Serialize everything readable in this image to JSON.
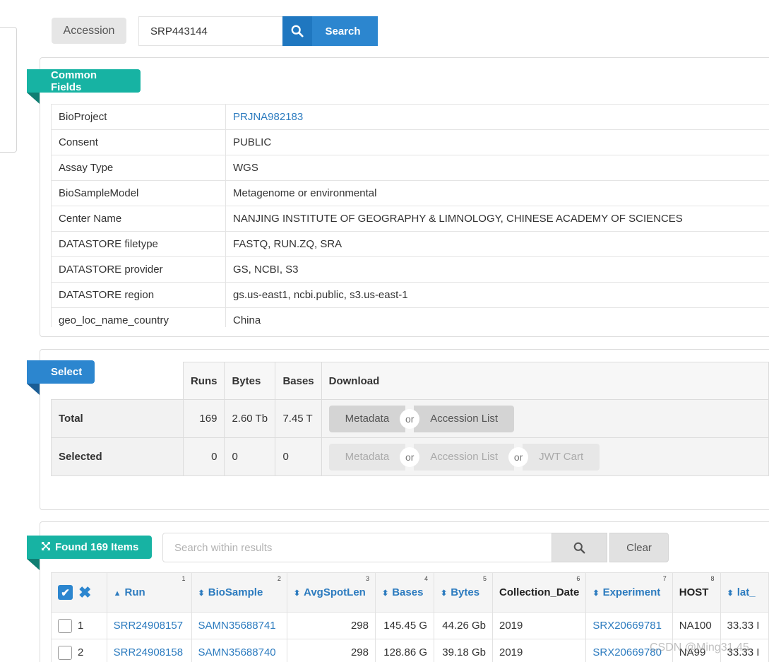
{
  "search": {
    "field_label": "Accession",
    "value": "SRP443144",
    "button_label": "Search"
  },
  "common_fields": {
    "title": "Common Fields",
    "rows": [
      {
        "key": "BioProject",
        "value": "PRJNA982183"
      },
      {
        "key": "Consent",
        "value": "PUBLIC"
      },
      {
        "key": "Assay Type",
        "value": "WGS"
      },
      {
        "key": "BioSampleModel",
        "value": "Metagenome or environmental"
      },
      {
        "key": "Center Name",
        "value": "NANJING INSTITUTE OF GEOGRAPHY & LIMNOLOGY, CHINESE ACADEMY OF SCIENCES"
      },
      {
        "key": "DATASTORE filetype",
        "value": "FASTQ, RUN.ZQ, SRA"
      },
      {
        "key": "DATASTORE provider",
        "value": "GS, NCBI, S3"
      },
      {
        "key": "DATASTORE region",
        "value": "gs.us-east1, ncbi.public, s3.us-east-1"
      },
      {
        "key": "geo_loc_name_country",
        "value": "China"
      }
    ]
  },
  "select": {
    "title": "Select",
    "headers": {
      "runs": "Runs",
      "bytes": "Bytes",
      "bases": "Bases",
      "download": "Download"
    },
    "total": {
      "label": "Total",
      "runs": "169",
      "bytes": "2.60 Tb",
      "bases": "7.45 T",
      "metadata": "Metadata",
      "or": "or",
      "accession_list": "Accession List"
    },
    "selected": {
      "label": "Selected",
      "runs": "0",
      "bytes": "0",
      "bases": "0",
      "metadata": "Metadata",
      "or": "or",
      "accession_list": "Accession List",
      "jwt_cart": "JWT Cart"
    }
  },
  "results": {
    "found_label": "Found 169 Items",
    "search_placeholder": "Search within results",
    "clear_label": "Clear",
    "columns": [
      {
        "label": "Run",
        "num": "1"
      },
      {
        "label": "BioSample",
        "num": "2"
      },
      {
        "label": "AvgSpotLen",
        "num": "3"
      },
      {
        "label": "Bases",
        "num": "4"
      },
      {
        "label": "Bytes",
        "num": "5"
      },
      {
        "label": "Collection_Date",
        "num": "6"
      },
      {
        "label": "Experiment",
        "num": "7"
      },
      {
        "label": "HOST",
        "num": "8"
      },
      {
        "label": "lat_",
        "num": ""
      }
    ],
    "rows": [
      {
        "idx": "1",
        "run": "SRR24908157",
        "biosample": "SAMN35688741",
        "avgspotlen": "298",
        "bases": "145.45 G",
        "bytes": "44.26 Gb",
        "collection_date": "2019",
        "experiment": "SRX20669781",
        "host": "NA100",
        "lat": "33.33 I"
      },
      {
        "idx": "2",
        "run": "SRR24908158",
        "biosample": "SAMN35688740",
        "avgspotlen": "298",
        "bases": "128.86 G",
        "bytes": "39.18 Gb",
        "collection_date": "2019",
        "experiment": "SRX20669780",
        "host": "NA99",
        "lat": "33.33 I"
      }
    ]
  },
  "watermark": "CSDN @Ming31.45"
}
